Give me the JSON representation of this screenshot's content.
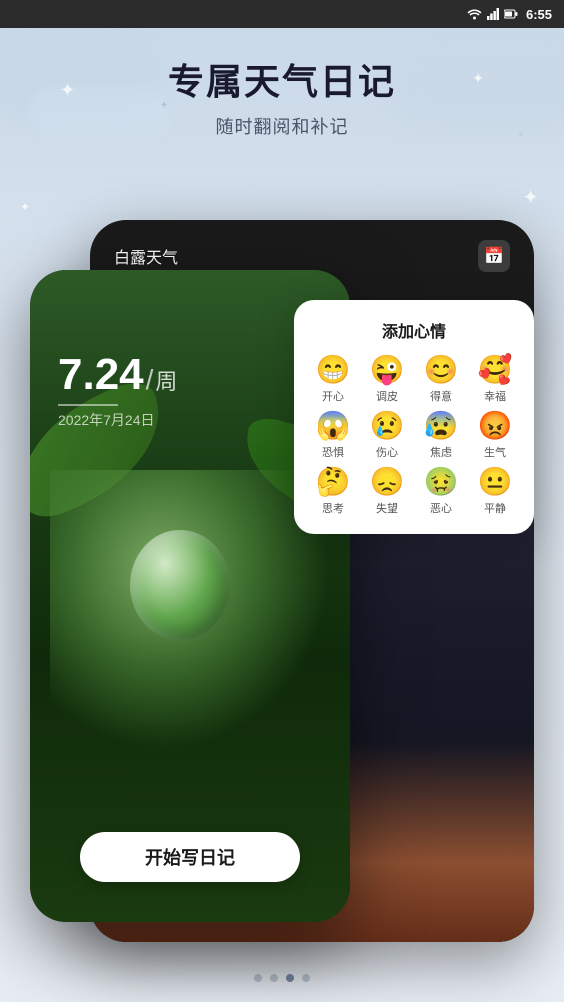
{
  "statusBar": {
    "time": "6:55",
    "icons": [
      "wifi",
      "signal",
      "battery"
    ]
  },
  "header": {
    "mainTitle": "专属天气日记",
    "subTitle": "随时翻阅和补记"
  },
  "phoneBg": {
    "title": "白露天气",
    "calendarIconLabel": "📅"
  },
  "phoneFg": {
    "dateNumber": "7.24",
    "dateSlash": "/",
    "dateWeek": "周",
    "dateFull": "2022年7月24日",
    "startButton": "开始写日记"
  },
  "moodPopup": {
    "title": "添加心情",
    "moods": [
      {
        "emoji": "😁",
        "label": "开心"
      },
      {
        "emoji": "😜",
        "label": "调皮"
      },
      {
        "emoji": "😊",
        "label": "得意"
      },
      {
        "emoji": "🥰",
        "label": "幸福"
      },
      {
        "emoji": "😱",
        "label": "恐惧"
      },
      {
        "emoji": "😢",
        "label": "伤心"
      },
      {
        "emoji": "😰",
        "label": "焦虑"
      },
      {
        "emoji": "😡",
        "label": "生气"
      },
      {
        "emoji": "🤔",
        "label": "思考"
      },
      {
        "emoji": "😞",
        "label": "失望"
      },
      {
        "emoji": "🤢",
        "label": "恶心"
      },
      {
        "emoji": "😐",
        "label": "平静"
      }
    ]
  },
  "pagination": {
    "dots": [
      false,
      false,
      true,
      false
    ]
  }
}
